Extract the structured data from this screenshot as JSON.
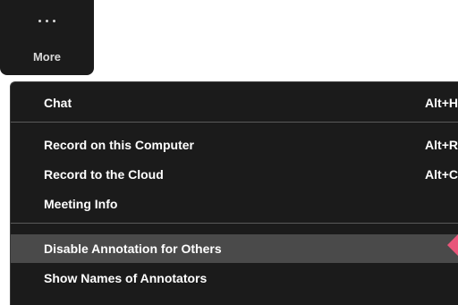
{
  "more": {
    "label": "More",
    "icon": "ellipsis-icon"
  },
  "menu": {
    "items": [
      {
        "label": "Chat",
        "shortcut": "Alt+H"
      },
      {
        "label": "Record on this Computer",
        "shortcut": "Alt+R"
      },
      {
        "label": "Record to the Cloud",
        "shortcut": "Alt+C"
      },
      {
        "label": "Meeting Info",
        "shortcut": ""
      },
      {
        "label": "Disable Annotation for Others",
        "shortcut": ""
      },
      {
        "label": "Show Names of Annotators",
        "shortcut": ""
      }
    ],
    "highlighted_item": "Disable Annotation for Others"
  },
  "colors": {
    "menu_background": "#1b1b1b",
    "highlight": "#4a4a4a",
    "text": "#ffffff",
    "pointer": "#e8567a"
  }
}
